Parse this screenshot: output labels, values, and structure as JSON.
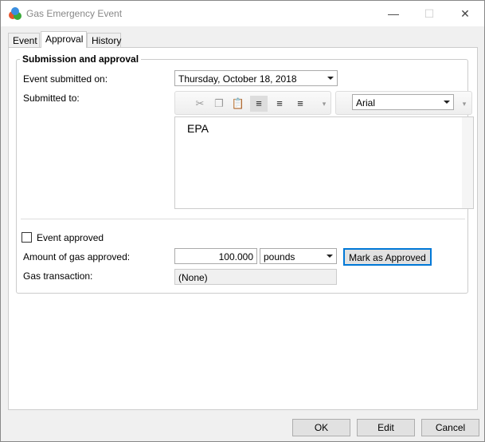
{
  "window": {
    "title": "Gas Emergency Event",
    "minimize": "—",
    "maximize": "☐",
    "close": "✕"
  },
  "tabs": [
    "Event",
    "Approval",
    "History"
  ],
  "group": {
    "title": "Submission and approval"
  },
  "fields": {
    "submitted_on_label": "Event submitted on:",
    "submitted_on_value": "Thursday, October 18, 2018",
    "submitted_to_label": "Submitted to:",
    "submitted_to_text": "EPA",
    "font_value": "Arial",
    "approved_label": "Event approved",
    "amount_label": "Amount of gas approved:",
    "amount_value": "100.000",
    "unit_value": "pounds",
    "mark_button": "Mark as Approved",
    "transaction_label": "Gas transaction:",
    "transaction_value": "(None)"
  },
  "footer": {
    "ok": "OK",
    "edit": "Edit",
    "cancel": "Cancel"
  }
}
